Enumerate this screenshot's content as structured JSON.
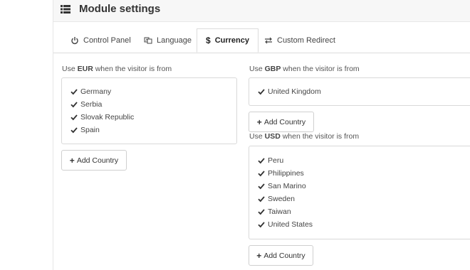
{
  "header": {
    "title": "Module settings",
    "icon": "list-icon"
  },
  "tabs": [
    {
      "label": "Control Panel",
      "icon": "power-icon"
    },
    {
      "label": "Language",
      "icon": "language-icon"
    },
    {
      "label": "Currency",
      "icon": "dollar-icon",
      "active": true
    },
    {
      "label": "Custom Redirect",
      "icon": "exchange-icon"
    }
  ],
  "groups": {
    "eur": {
      "prefix": "Use",
      "currency": "EUR",
      "suffix": "when the visitor is from",
      "countries": [
        "Germany",
        "Serbia",
        "Slovak Republic",
        "Spain"
      ],
      "add_label": "Add Country"
    },
    "gbp": {
      "prefix": "Use",
      "currency": "GBP",
      "suffix": "when the visitor is from",
      "countries": [
        "United Kingdom"
      ],
      "add_label": "Add Country"
    },
    "usd": {
      "prefix": "Use",
      "currency": "USD",
      "suffix": "when the visitor is from",
      "countries": [
        "Peru",
        "Philippines",
        "San Marino",
        "Sweden",
        "Taiwan",
        "United States"
      ],
      "add_label": "Add Country"
    }
  },
  "colors": {
    "header_bg": "#f7f7f7",
    "border": "#d9d9d9",
    "text": "#444444"
  }
}
